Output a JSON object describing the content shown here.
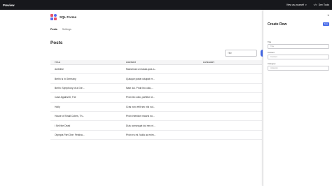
{
  "topbar": {
    "title": "Preview",
    "view_as": "View as yourself",
    "dev_label": "Dev Tools"
  },
  "app": {
    "name": "SQL Forms",
    "nav": [
      "Posts",
      "Settings"
    ]
  },
  "main": {
    "title": "Posts",
    "search_placeholder": "Title",
    "columns": [
      "TITLE",
      "CONTENT",
      "CATEGORY"
    ],
    "rows": [
      {
        "title": "Ambitive",
        "content": "Maecenas ut massa quis a...",
        "category": ""
      },
      {
        "title": "Berlin Is in Germany",
        "content": "Quisque porta volutpat er...",
        "category": ""
      },
      {
        "title": "Berlin: Symphony of a Gre...",
        "content": "Nam dui. Proin leo odio,...",
        "category": ""
      },
      {
        "title": "Case Against 8, The",
        "content": "Proin leo odio, porttitor id...",
        "category": ""
      },
      {
        "title": "Holly",
        "content": "Cras non velit nec nisi vul...",
        "category": ""
      },
      {
        "title": "House of Small Cubes, Th...",
        "content": "Proin interdum mauris no...",
        "category": ""
      },
      {
        "title": "I Sell the Dead",
        "content": "Duis consequat dui nec ni...",
        "category": ""
      },
      {
        "title": "Olympia Part One: Festiva...",
        "content": "Proin eu mi. Nulla ac enim...",
        "category": ""
      }
    ]
  },
  "panel": {
    "title": "Create Row",
    "save_label": "Save",
    "collapse_icon": "collapse-right-icon",
    "fields": [
      {
        "label": "Title",
        "placeholder": "Title"
      },
      {
        "label": "Content",
        "placeholder": "Content"
      },
      {
        "label": "Category",
        "placeholder": "category"
      }
    ]
  },
  "colors": {
    "accent": "#4468e8",
    "topbar": "#17181c",
    "logo_red": "#e7546a",
    "logo_blue": "#5b6cf0"
  }
}
